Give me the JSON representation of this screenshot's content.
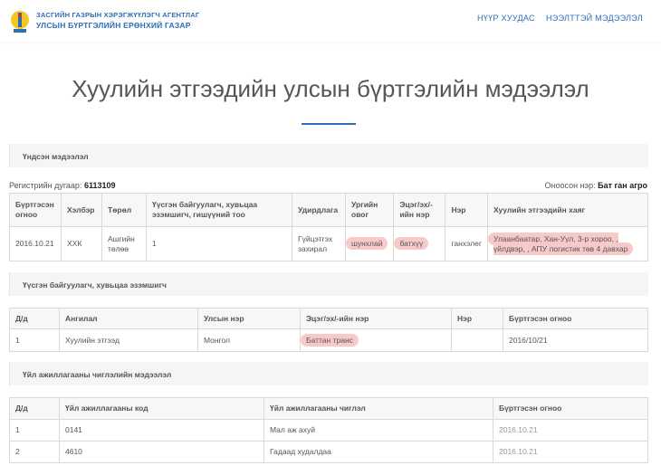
{
  "header": {
    "org_line1": "ЗАСГИЙН ГАЗРЫН ХЭРЭГЖҮҮЛЭГЧ АГЕНТЛАГ",
    "org_line2": "УЛСЫН БҮРТГЭЛИЙН ЕРӨНХИЙ ГАЗАР",
    "nav": [
      "НҮҮР ХУУДАС",
      "НЭЭЛТТЭЙ МЭДЭЭЛЭЛ"
    ]
  },
  "page_title": "Хуулийн этгээдийн улсын бүртгэлийн мэдээлэл",
  "sections": {
    "basic": "Үндсэн мэдээлэл",
    "founders": "Үүсгэн байгуулагч, хувьцаа эзэмшигч",
    "activities": "Үйл ажиллагааны чиглэлийн мэдээлэл"
  },
  "registry": {
    "number_label": "Регистрийн дугаар:",
    "number_value": "6113109",
    "short_label": "Оноосон нэр:",
    "short_value": "Бат ган агро"
  },
  "basic_table": {
    "headers": [
      "Бүртгэсэн огноо",
      "Хэлбэр",
      "Төрөл",
      "Үүсгэн байгуулагч, хувьцаа эзэмшигч, гишүүний тоо",
      "Удирдлага",
      "Ургийн овог",
      "Эцэг/эх/-ийн нэр",
      "Нэр",
      "Хуулийн этгээдийн хаяг"
    ],
    "row": [
      "2016.10.21",
      "ХХК",
      "Ашгийн төлөө",
      "1",
      "Гүйцэтгэх захирал",
      "шунхлай",
      "батхүү",
      "ганхэлег",
      "Улаанбаатар, Хан-Уул, 3-р хороо, , үйлдвэр, , АПУ логистик төв 4 давхар"
    ]
  },
  "founders_table": {
    "headers": [
      "Д/д",
      "Ангилал",
      "Улсын нэр",
      "Эцэг/эх/-ийн нэр",
      "Нэр",
      "Бүртгэсэн огноо"
    ],
    "rows": [
      [
        "1",
        "Хуулийн этгээд",
        "Монгол",
        "Баттан транс",
        "",
        "2016/10/21"
      ]
    ]
  },
  "activities_table": {
    "headers": [
      "Д/д",
      "Үйл ажиллагааны код",
      "Үйл ажиллагааны чиглэл",
      "Бүртгэсэн огноо"
    ],
    "rows": [
      [
        "1",
        "0141",
        "Мал аж ахуй",
        "2016.10.21"
      ],
      [
        "2",
        "4610",
        "Гадаад худалдаа",
        "2016.10.21"
      ]
    ]
  },
  "colors": {
    "accent": "#2c6fb7",
    "highlight": "#f8c9c9"
  }
}
